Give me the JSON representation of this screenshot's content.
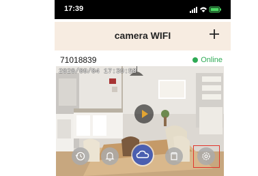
{
  "status_bar": {
    "time": "17:39"
  },
  "header": {
    "title": "camera WIFI",
    "add_icon": "plus-icon"
  },
  "device": {
    "id": "71018839",
    "status": "Online",
    "status_color": "#2eaa55",
    "timestamp": "2020/09/04 17:39:58"
  },
  "actions": [
    {
      "name": "playback",
      "icon": "playback-icon"
    },
    {
      "name": "alarm",
      "icon": "bell-icon"
    },
    {
      "name": "cloud",
      "icon": "cloud-icon"
    },
    {
      "name": "storage",
      "icon": "sd-card-icon"
    },
    {
      "name": "settings",
      "icon": "gear-icon"
    }
  ],
  "colors": {
    "header_bg": "#f7ece1",
    "cloud_button": "#4b5fb0",
    "play_accent": "#e3a532",
    "highlight": "#e0332a"
  }
}
